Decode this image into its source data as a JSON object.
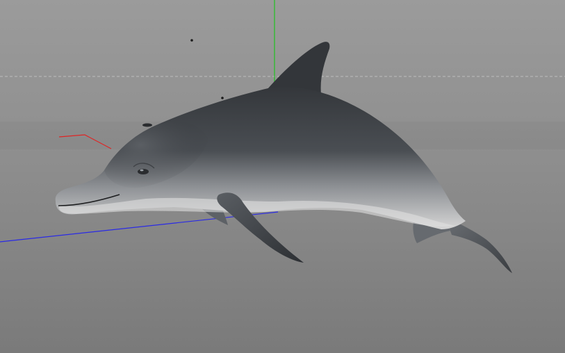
{
  "viewport": {
    "background_top": "#9a9a9a",
    "background_bottom": "#7c7c7c",
    "horizon_line_color": "#b8b8b8"
  },
  "axes": {
    "x_axis_color": "#e02020",
    "y_axis_color": "#18c018",
    "z_axis_color": "#2828e0"
  },
  "model": {
    "name_icon": "dolphin-model",
    "dorsal_color": "#3a3d41",
    "belly_color": "#d2d2d2"
  }
}
